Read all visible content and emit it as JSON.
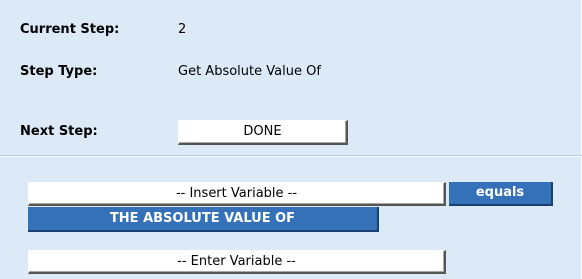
{
  "current_step": {
    "label": "Current Step:",
    "value": "2"
  },
  "step_type": {
    "label": "Step Type:",
    "value": "Get Absolute Value Of"
  },
  "next_step": {
    "label": "Next Step:",
    "button": "DONE"
  },
  "expression": {
    "insert_variable": "-- Insert Variable --",
    "operator": "equals",
    "function": "THE ABSOLUTE VALUE OF",
    "enter_variable": "-- Enter Variable --"
  },
  "colors": {
    "panel": "#dce9f7",
    "accent": "#3471b8"
  }
}
